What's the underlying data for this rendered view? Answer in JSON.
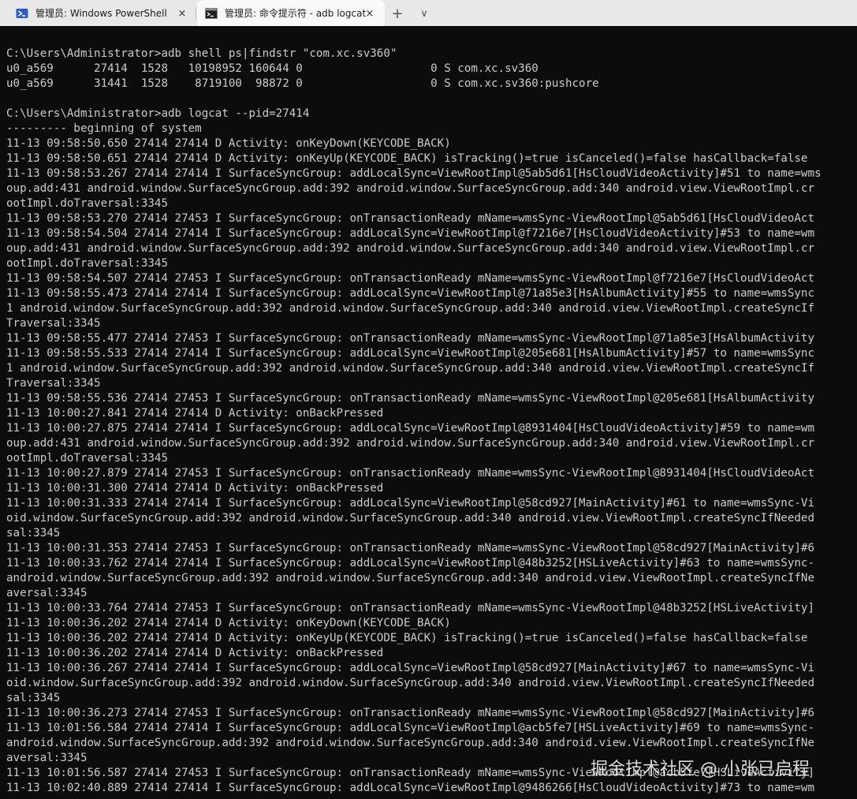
{
  "tabs": [
    {
      "title": "管理员: Windows PowerShell",
      "close_icon": "×",
      "icon": "powershell-icon",
      "active": false
    },
    {
      "title": "管理员: 命令提示符 - adb  logcat",
      "close_icon": "×",
      "icon": "command-prompt-icon",
      "active": true
    }
  ],
  "tabbar": {
    "new_tab": "+",
    "dropdown": "∨"
  },
  "colors": {
    "terminal_bg": "#0c0c0c",
    "terminal_fg": "#cccccc",
    "tabbar_bg": "#e8e8e8",
    "active_tab_bg": "#f9f9f9",
    "powershell_blue": "#2d5dc4"
  },
  "terminal": {
    "lines": [
      "C:\\Users\\Administrator>adb shell ps|findstr \"com.xc.sv360\"",
      "u0_a569      27414  1528   10198952 160644 0                   0 S com.xc.sv360",
      "u0_a569      31441  1528    8719100  98872 0                   0 S com.xc.sv360:pushcore",
      "",
      "C:\\Users\\Administrator>adb logcat --pid=27414",
      "--------- beginning of system",
      "11-13 09:58:50.650 27414 27414 D Activity: onKeyDown(KEYCODE_BACK)",
      "11-13 09:58:50.651 27414 27414 D Activity: onKeyUp(KEYCODE_BACK) isTracking()=true isCanceled()=false hasCallback=false",
      "11-13 09:58:53.267 27414 27414 I SurfaceSyncGroup: addLocalSync=ViewRootImpl@5ab5d61[HsCloudVideoActivity]#51 to name=wms",
      "oup.add:431 android.window.SurfaceSyncGroup.add:392 android.window.SurfaceSyncGroup.add:340 android.view.ViewRootImpl.cr",
      "ootImpl.doTraversal:3345",
      "11-13 09:58:53.270 27414 27453 I SurfaceSyncGroup: onTransactionReady mName=wmsSync-ViewRootImpl@5ab5d61[HsCloudVideoAct",
      "11-13 09:58:54.504 27414 27414 I SurfaceSyncGroup: addLocalSync=ViewRootImpl@f7216e7[HsCloudVideoActivity]#53 to name=wm",
      "oup.add:431 android.window.SurfaceSyncGroup.add:392 android.window.SurfaceSyncGroup.add:340 android.view.ViewRootImpl.cr",
      "ootImpl.doTraversal:3345",
      "11-13 09:58:54.507 27414 27453 I SurfaceSyncGroup: onTransactionReady mName=wmsSync-ViewRootImpl@f7216e7[HsCloudVideoAct",
      "11-13 09:58:55.473 27414 27414 I SurfaceSyncGroup: addLocalSync=ViewRootImpl@71a85e3[HsAlbumActivity]#55 to name=wmsSync",
      "1 android.window.SurfaceSyncGroup.add:392 android.window.SurfaceSyncGroup.add:340 android.view.ViewRootImpl.createSyncIf",
      "Traversal:3345",
      "11-13 09:58:55.477 27414 27453 I SurfaceSyncGroup: onTransactionReady mName=wmsSync-ViewRootImpl@71a85e3[HsAlbumActivity",
      "11-13 09:58:55.533 27414 27414 I SurfaceSyncGroup: addLocalSync=ViewRootImpl@205e681[HsAlbumActivity]#57 to name=wmsSync",
      "1 android.window.SurfaceSyncGroup.add:392 android.window.SurfaceSyncGroup.add:340 android.view.ViewRootImpl.createSyncIf",
      "Traversal:3345",
      "11-13 09:58:55.536 27414 27453 I SurfaceSyncGroup: onTransactionReady mName=wmsSync-ViewRootImpl@205e681[HsAlbumActivity",
      "11-13 10:00:27.841 27414 27414 D Activity: onBackPressed",
      "11-13 10:00:27.875 27414 27414 I SurfaceSyncGroup: addLocalSync=ViewRootImpl@8931404[HsCloudVideoActivity]#59 to name=wm",
      "oup.add:431 android.window.SurfaceSyncGroup.add:392 android.window.SurfaceSyncGroup.add:340 android.view.ViewRootImpl.cr",
      "ootImpl.doTraversal:3345",
      "11-13 10:00:27.879 27414 27453 I SurfaceSyncGroup: onTransactionReady mName=wmsSync-ViewRootImpl@8931404[HsCloudVideoAct",
      "11-13 10:00:31.300 27414 27414 D Activity: onBackPressed",
      "11-13 10:00:31.333 27414 27414 I SurfaceSyncGroup: addLocalSync=ViewRootImpl@58cd927[MainActivity]#61 to name=wmsSync-Vi",
      "oid.window.SurfaceSyncGroup.add:392 android.window.SurfaceSyncGroup.add:340 android.view.ViewRootImpl.createSyncIfNeeded",
      "sal:3345",
      "11-13 10:00:31.353 27414 27453 I SurfaceSyncGroup: onTransactionReady mName=wmsSync-ViewRootImpl@58cd927[MainActivity]#6",
      "11-13 10:00:33.762 27414 27414 I SurfaceSyncGroup: addLocalSync=ViewRootImpl@48b3252[HSLiveActivity]#63 to name=wmsSync-",
      "android.window.SurfaceSyncGroup.add:392 android.window.SurfaceSyncGroup.add:340 android.view.ViewRootImpl.createSyncIfNe",
      "aversal:3345",
      "11-13 10:00:33.764 27414 27453 I SurfaceSyncGroup: onTransactionReady mName=wmsSync-ViewRootImpl@48b3252[HSLiveActivity]",
      "11-13 10:00:36.202 27414 27414 D Activity: onKeyDown(KEYCODE_BACK)",
      "11-13 10:00:36.202 27414 27414 D Activity: onKeyUp(KEYCODE_BACK) isTracking()=true isCanceled()=false hasCallback=false",
      "11-13 10:00:36.202 27414 27414 D Activity: onBackPressed",
      "11-13 10:00:36.267 27414 27414 I SurfaceSyncGroup: addLocalSync=ViewRootImpl@58cd927[MainActivity]#67 to name=wmsSync-Vi",
      "oid.window.SurfaceSyncGroup.add:392 android.window.SurfaceSyncGroup.add:340 android.view.ViewRootImpl.createSyncIfNeeded",
      "sal:3345",
      "11-13 10:00:36.273 27414 27453 I SurfaceSyncGroup: onTransactionReady mName=wmsSync-ViewRootImpl@58cd927[MainActivity]#6",
      "11-13 10:01:56.584 27414 27414 I SurfaceSyncGroup: addLocalSync=ViewRootImpl@acb5fe7[HSLiveActivity]#69 to name=wmsSync-",
      "android.window.SurfaceSyncGroup.add:392 android.window.SurfaceSyncGroup.add:340 android.view.ViewRootImpl.createSyncIfNe",
      "aversal:3345",
      "11-13 10:01:56.587 27414 27453 I SurfaceSyncGroup: onTransactionReady mName=wmsSync-ViewRootImpl@acb5fe7[HSLiveActivity]",
      "11-13 10:02:40.889 27414 27414 I SurfaceSyncGroup: addLocalSync=ViewRootImpl@9486266[HsCloudVideoActivity]#73 to name=wm"
    ]
  },
  "watermark": "掘金技术社区 @ 小张已启程"
}
